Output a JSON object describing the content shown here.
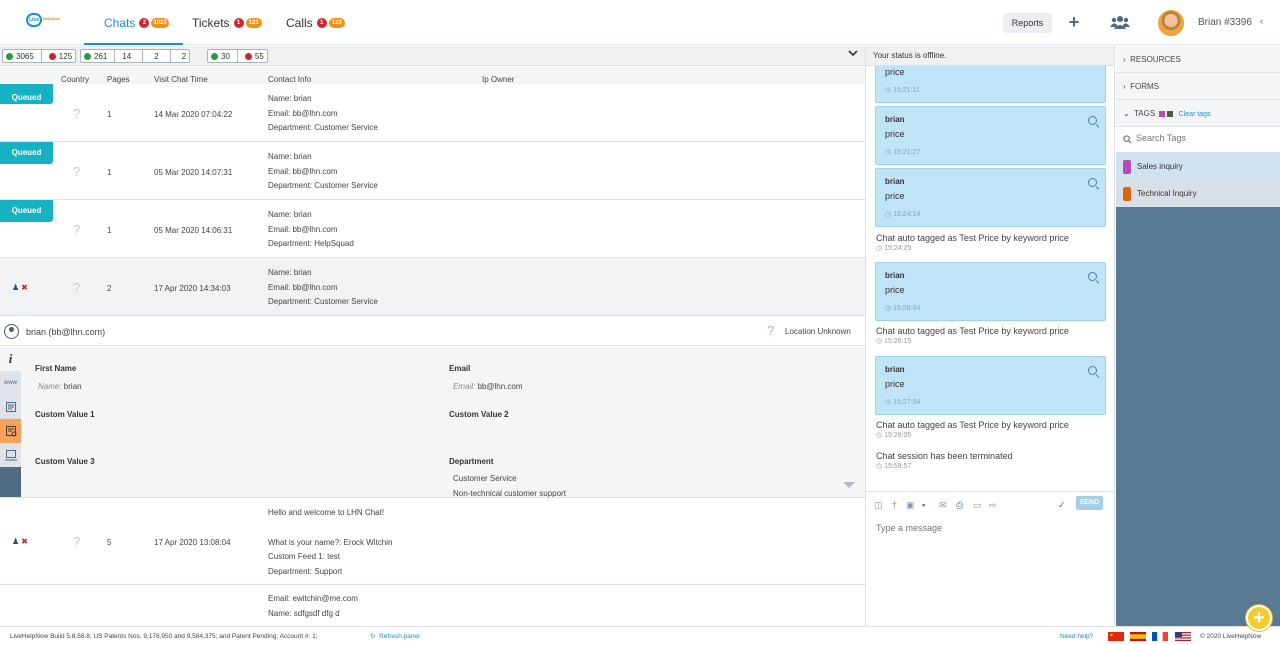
{
  "logo": {
    "main": "Live",
    "text": "HelpNow"
  },
  "header": {
    "tabs": [
      {
        "label": "Chats",
        "red": "2",
        "orange": "1023"
      },
      {
        "label": "Tickets",
        "red": "1",
        "orange": "123"
      },
      {
        "label": "Calls",
        "red": "1",
        "orange": "123"
      }
    ],
    "reports": "Reports",
    "plus": "+",
    "user": "Brian #3396",
    "caret": "‹"
  },
  "counters": {
    "g1": "3065",
    "r1": "125",
    "g2": "261",
    "c2": "14",
    "c3": "2",
    "c4": "2",
    "g3": "30",
    "r3": "55"
  },
  "columns": {
    "country": "Country",
    "pages": "Pages",
    "visit": "Visit Chat Time",
    "contact": "Contact Info",
    "ip": "Ip Owner"
  },
  "rows": [
    {
      "status": "Queued",
      "country": "?",
      "pages": "1",
      "time": "14 Mar 2020 07:04:22",
      "c1": "Name: brian",
      "c2": "Email: bb@lhn.com",
      "c3": "Department: Customer Service"
    },
    {
      "status": "Queued",
      "country": "?",
      "pages": "1",
      "time": "05 Mar 2020 14:07:31",
      "c1": "Name: brian",
      "c2": "Email: bb@lhn.com",
      "c3": "Department: Customer Service"
    },
    {
      "status": "Queued",
      "country": "?",
      "pages": "1",
      "time": "05 Mar 2020 14:06:31",
      "c1": "Name: brian",
      "c2": "Email: bb@lhn.com",
      "c3": "Department: HelpSquad"
    },
    {
      "status": "",
      "country": "?",
      "pages": "2",
      "time": "17 Apr 2020 14:34:03",
      "c1": "Name: brian",
      "c2": "Email: bb@lhn.com",
      "c3": "Department: Customer Service"
    }
  ],
  "detail": {
    "user": "brian (bb@lhn.com)",
    "loc_q": "?",
    "location": "Location Unknown",
    "tab_info": "i",
    "tab_www": "www",
    "first_name_label": "First Name",
    "first_name_key": "Name:",
    "first_name_val": "brian",
    "email_label": "Email",
    "email_key": "Email:",
    "email_val": "bb@lhn.com",
    "cv1": "Custom Value 1",
    "cv2": "Custom Value 2",
    "cv3": "Custom Value 3",
    "dept_label": "Department",
    "dept1": "Customer Service",
    "dept2": "Non-technical customer support"
  },
  "msgrow": {
    "country": "?",
    "pages": "5",
    "time": "17 Apr 2020 13:08:04",
    "l1": "Hello and welcome to LHN Chat!",
    "l2": "What is your name?: Erock Witchin",
    "l3": "Custom Feed 1: test",
    "l4": "Department: Support"
  },
  "lastrow": {
    "l1": "Email: ewitchin@me.com",
    "l2": "Name: sdfgsdf dfg d"
  },
  "chat": {
    "status": "Your status is offline.",
    "partial_text": "price",
    "partial_time": "15:21:11",
    "messages": [
      {
        "who": "brian",
        "text": "price",
        "time": "15:21:27"
      },
      {
        "who": "brian",
        "text": "price",
        "time": "15:24:14"
      },
      {
        "who": "brian",
        "text": "price",
        "time": "15:26:04"
      },
      {
        "who": "brian",
        "text": "price",
        "time": "15:27:54"
      }
    ],
    "systems": [
      {
        "text": "Chat auto tagged as Test Price by keyword price",
        "time": "15:24:25"
      },
      {
        "text": "Chat auto tagged as Test Price by keyword price",
        "time": "15:26:15"
      },
      {
        "text": "Chat auto tagged as Test Price by keyword price",
        "time": "15:28:05"
      },
      {
        "text": "Chat session has been terminated",
        "time": "15:59:57"
      }
    ],
    "send": "SEND",
    "placeholder": "Type a message"
  },
  "sidebar": {
    "resources": "RESOURCES",
    "forms": "FORMS",
    "tags": "TAGS",
    "clear": "Clear tags",
    "search_placeholder": "Search Tags",
    "tag1": "Sales inquiry",
    "tag2": "Technical Inquiry",
    "tag1_color": "#b44bb8",
    "tag2_color": "#d9650f"
  },
  "footer": {
    "build": "LiveHelpNow Build 5.8.58.8; US Patents Nos. 9,178,950 and 9,584,375; and Patent Pending; Account #: 1;",
    "refresh": "Refresh panel",
    "help": "Need help?",
    "copyright": "© 2020 LiveHelpNow"
  }
}
